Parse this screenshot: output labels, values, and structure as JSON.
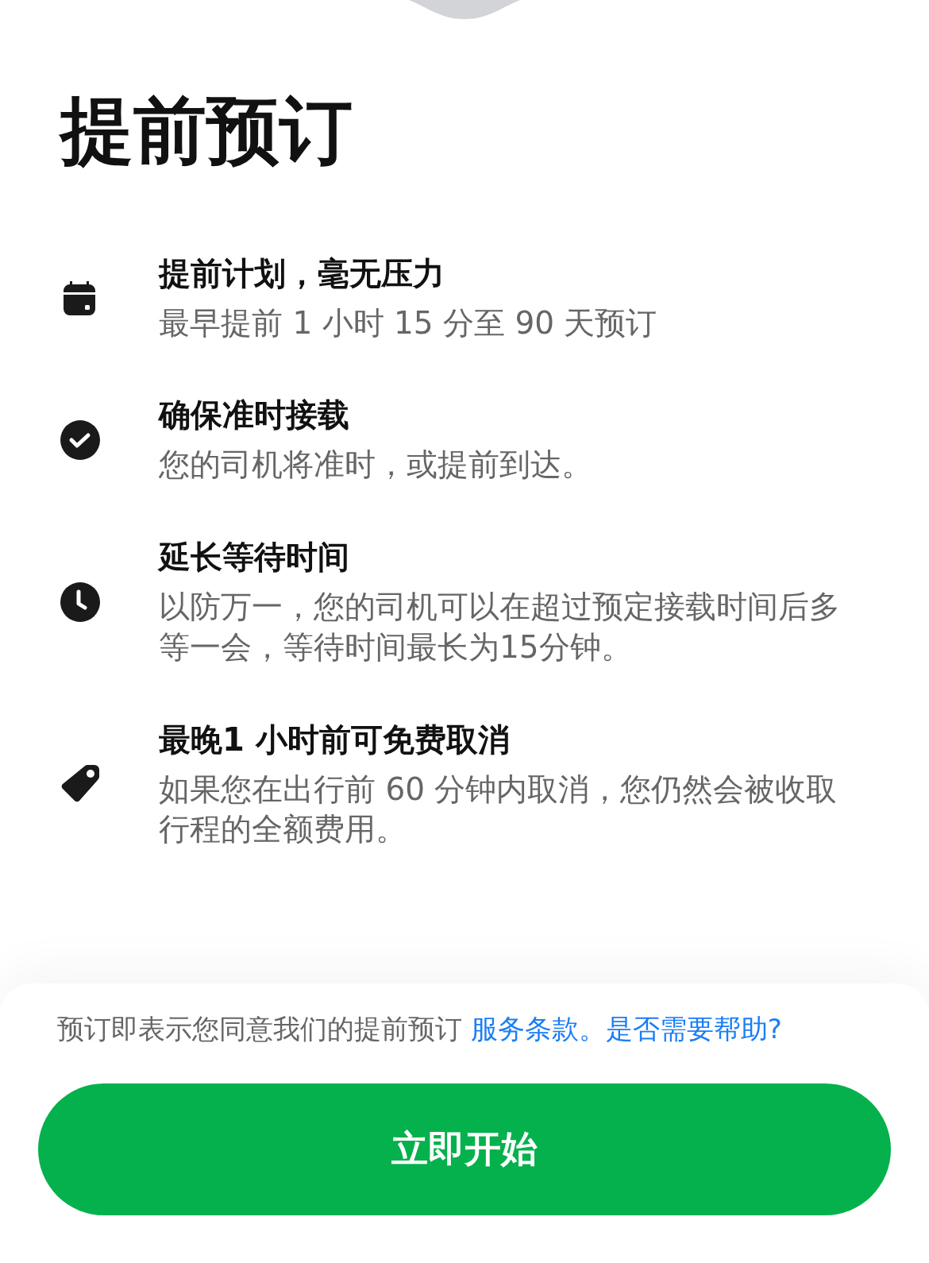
{
  "title": "提前预订",
  "features": [
    {
      "kind": "calendar",
      "title": "提前计划，毫无压力",
      "description": "最早提前 1 小时 15 分至 90 天预订"
    },
    {
      "kind": "check",
      "title": "确保准时接载",
      "description": "您的司机将准时，或提前到达。"
    },
    {
      "kind": "clock",
      "title": "延长等待时间",
      "description": "以防万一，您的司机可以在超过预定接载时间后多等一会，等待时间最长为15分钟。"
    },
    {
      "kind": "tag",
      "title": "最晚1 小时前可免费取消",
      "description": "如果您在出行前 60 分钟内取消，您仍然会被收取行程的全额费用。"
    }
  ],
  "footer": {
    "text": "预订即表示您同意我们的提前预订 ",
    "terms_link": "服务条款。",
    "help_link": "是否需要帮助?"
  },
  "button": "立即开始"
}
